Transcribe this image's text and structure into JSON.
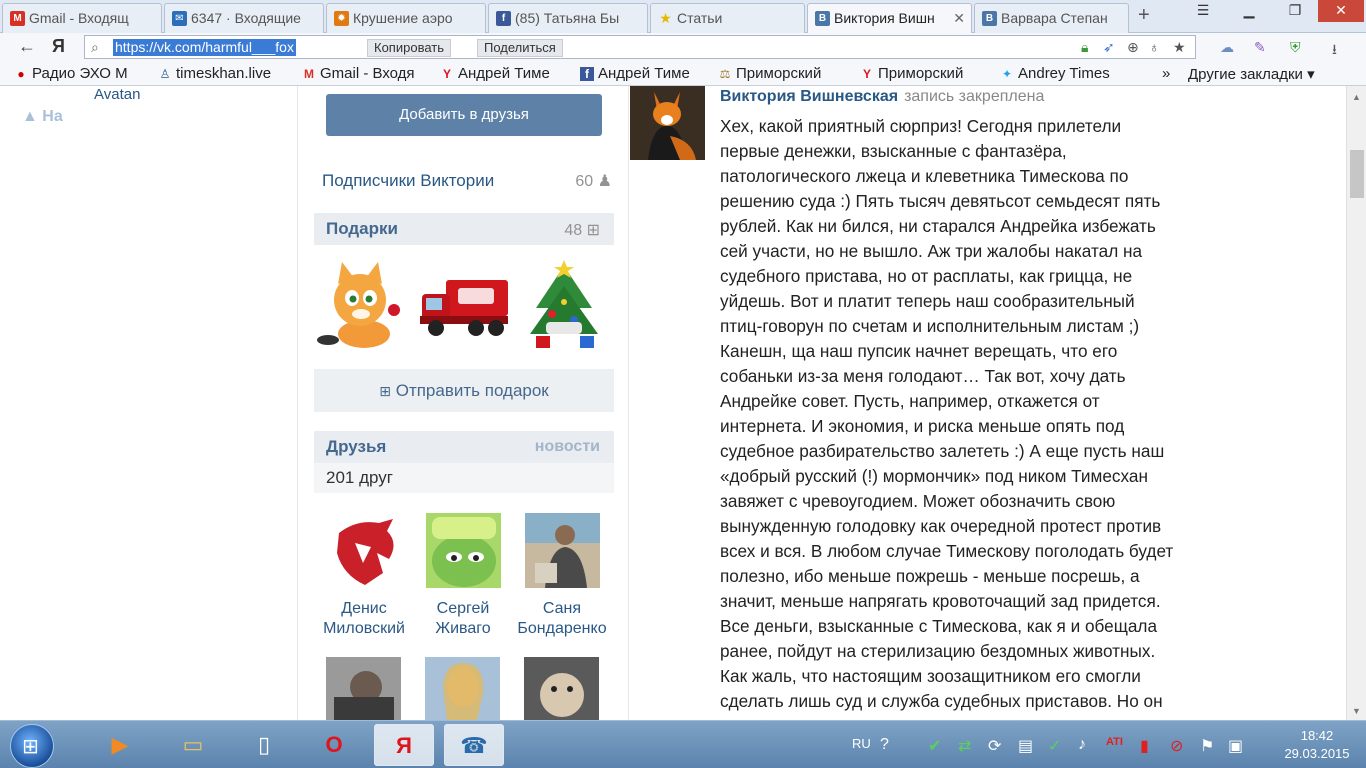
{
  "browser": {
    "tabs": [
      {
        "title": "Gmail - Входящ",
        "icon": "gmail-icon",
        "color": "#d93025"
      },
      {
        "title": "6347 · Входящие",
        "icon": "mail-icon",
        "color": "#2c6fb8"
      },
      {
        "title": "Крушение аэро",
        "icon": "news-icon",
        "color": "#e07a10"
      },
      {
        "title": "(85) Татьяна Бы",
        "icon": "facebook-icon",
        "color": "#3b5998"
      },
      {
        "title": "Статьи",
        "icon": "star-icon",
        "color": "#e6b800"
      },
      {
        "title": "Виктория Вишн",
        "icon": "vk-icon",
        "color": "#4a76a8"
      },
      {
        "title": "Варвара Степан",
        "icon": "vk-icon",
        "color": "#4a76a8"
      }
    ],
    "new_tab": "+",
    "url": "https://vk.com/harmful___fox",
    "copy_label": "Копировать",
    "share_label": "Поделиться",
    "bookmarks": [
      {
        "label": "Радио ЭХО М",
        "icon": "radio-icon"
      },
      {
        "label": "timeskhan.live",
        "icon": "user-icon"
      },
      {
        "label": "Gmail - Входя",
        "icon": "gmail-icon"
      },
      {
        "label": "Андрей Тиме",
        "icon": "yandex-icon"
      },
      {
        "label": "Андрей Тиме",
        "icon": "facebook-icon"
      },
      {
        "label": "Приморский",
        "icon": "scales-icon"
      },
      {
        "label": "Приморский",
        "icon": "yandex-icon"
      },
      {
        "label": "Andrey Times",
        "icon": "twitter-icon"
      }
    ],
    "more_bookmarks": "»",
    "other_bookmarks": "Другие закладки ▾"
  },
  "left": {
    "avatan": "Avatan",
    "up_label": "На"
  },
  "profile": {
    "add_friend": "Добавить в друзья",
    "subscribers_label": "Подписчики Виктории",
    "subscribers_count": "60",
    "gifts_label": "Подарки",
    "gifts_count": "48",
    "send_gift": "Отправить подарок",
    "friends_label": "Друзья",
    "friends_news": "новости",
    "friends_count": "201 друг",
    "friends": [
      {
        "first": "Денис",
        "last": "Миловский",
        "color": "#c9202a"
      },
      {
        "first": "Сергей",
        "last": "Живаго",
        "color": "#6bb34a"
      },
      {
        "first": "Саня",
        "last": "Бондаренко",
        "color": "#8a7a6a"
      }
    ]
  },
  "post": {
    "author": "Виктория Вишневская",
    "note": "запись закреплена",
    "lines": [
      "Хех, какой приятный сюрприз! Сегодня прилетели",
      "первые денежки, взысканные с фантазёра,",
      "патологического лжеца и клеветника Тимескова по",
      "решению суда :) Пять тысяч девятьсот семьдесят пять",
      "рублей. Как ни бился, ни старался Андрейка избежать",
      "сей участи, но не вышло. Аж три жалобы накатал на",
      "судебного пристава, но от расплаты, как грицца, не",
      "уйдешь. Вот и платит теперь наш сообразительный",
      "птиц-говорун по счетам и исполнительным листам ;)",
      "Канешн, ща наш пупсик начнет верещать, что его",
      "собаньки из-за меня голодают… Так вот, хочу дать",
      "Андрейке совет. Пусть, например, откажется от",
      "интернета. И экономия, и риска меньше опять под",
      "судебное разбирательство залететь :) А еще пусть наш",
      "«добрый русский (!) мормончик» под ником Тимесхан",
      "завяжет с чревоугодием. Может обозначить свою",
      "вынужденную голодовку как очередной протест против",
      "всех и вся. В любом случае Тимескову поголодать будет",
      "полезно, ибо меньше пожрешь - меньше посрешь, а",
      "значит, меньше напрягать кровоточащий зад придется.",
      "Все деньги, взысканные с Тимескова, как я и обещала",
      "ранее, пойдут на стерилизацию бездомных животных.",
      "Как жаль, что настоящим зоозащитником его смогли",
      "сделать лишь суд и служба судебных приставов. Но он"
    ]
  },
  "taskbar": {
    "apps": [
      {
        "name": "media-player",
        "glyph": "▶",
        "color": "#f08a24"
      },
      {
        "name": "explorer",
        "glyph": "▭",
        "color": "#e8c25a"
      },
      {
        "name": "notepad",
        "glyph": "▯",
        "color": "#ffffff"
      },
      {
        "name": "opera",
        "glyph": "O",
        "color": "#e0141b"
      },
      {
        "name": "yandex-browser",
        "glyph": "Я",
        "color": "#e0141b"
      },
      {
        "name": "phone-app",
        "glyph": "☎",
        "color": "#2a6aa8"
      }
    ],
    "lang": "RU",
    "time": "18:42",
    "date": "29.03.2015"
  }
}
